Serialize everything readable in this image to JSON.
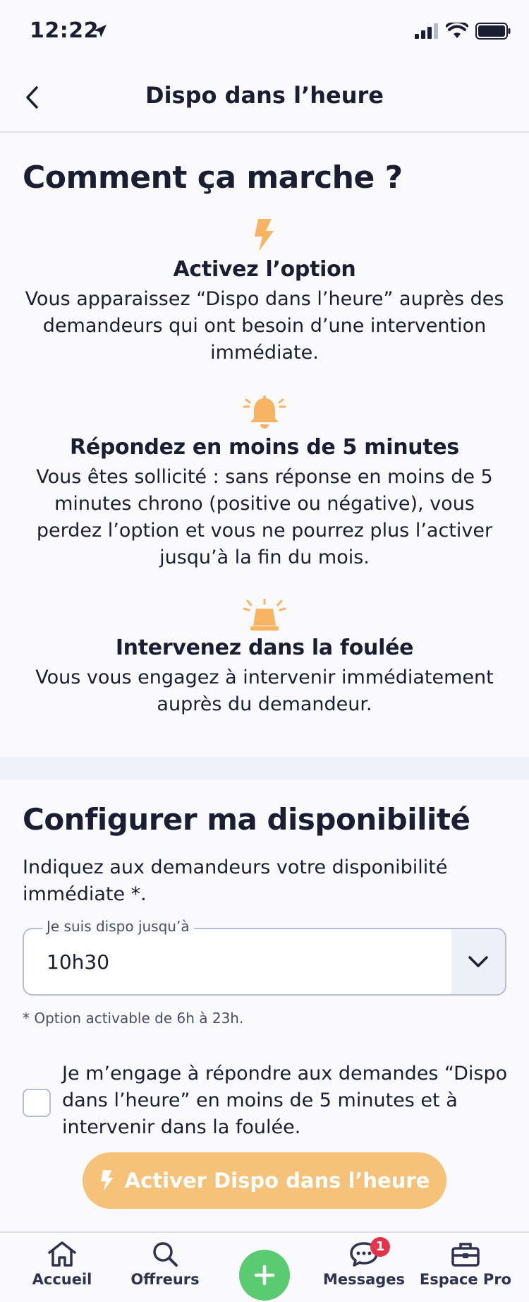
{
  "status_bar": {
    "time": "12:22"
  },
  "header": {
    "title": "Dispo dans l’heure"
  },
  "how_it_works": {
    "title": "Comment ça marche ?",
    "steps": [
      {
        "icon": "lightning-icon",
        "title": "Activez l’option",
        "description": "Vous apparaissez “Dispo dans l’heure” auprès des demandeurs qui ont besoin d’une intervention immédiate."
      },
      {
        "icon": "bell-icon",
        "title": "Répondez en moins de 5 minutes",
        "description": "Vous êtes sollicité : sans réponse en moins de 5 minutes chrono (positive ou négative), vous perdez l’option et vous ne pourrez plus l’activer jusqu’à la fin du mois."
      },
      {
        "icon": "siren-icon",
        "title": "Intervenez dans la foulée",
        "description": "Vous vous engagez à intervenir immédiatement auprès du demandeur."
      }
    ]
  },
  "config": {
    "title": "Configurer ma disponibilité",
    "description": "Indiquez aux demandeurs votre disponibilité immédiate *.",
    "select_label": "Je suis dispo jusqu’à",
    "select_value": "10h30",
    "note": "* Option activable de 6h à 23h.",
    "commitment": "Je m’engage à répondre aux demandes “Dispo dans l’heure” en moins de 5 minutes et à intervenir dans la foulée.",
    "cta_label": "Activer Dispo dans l’heure"
  },
  "tabbar": {
    "items": [
      {
        "label": "Accueil"
      },
      {
        "label": "Offreurs"
      },
      {
        "label": "Messages",
        "badge": "1"
      },
      {
        "label": "Espace Pro"
      }
    ]
  },
  "colors": {
    "accent": "#f6c178",
    "icon_orange": "#f7b463",
    "green": "#5bcb72",
    "badge_red": "#e5344a",
    "text": "#1b1e33"
  }
}
